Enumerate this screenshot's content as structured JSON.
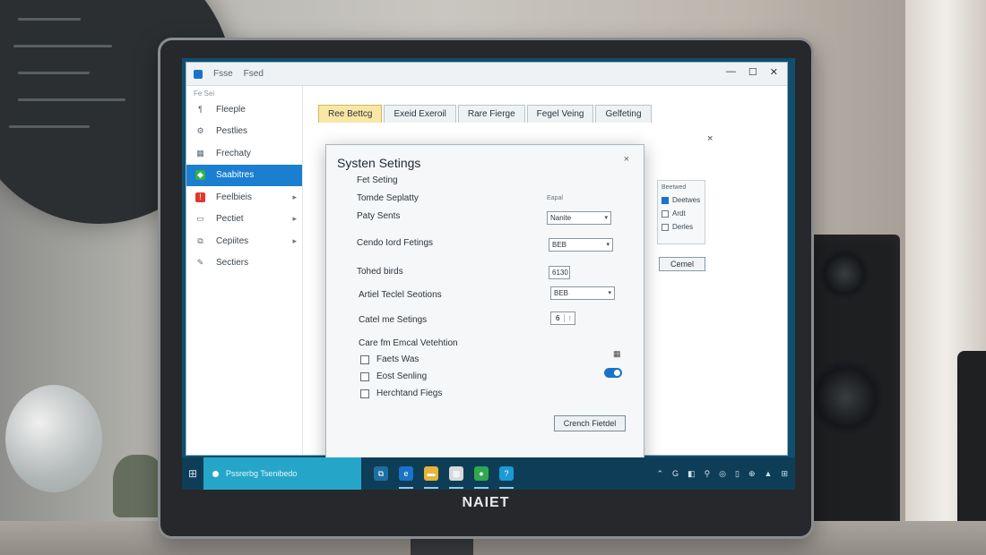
{
  "monitor": {
    "brand": "NAIET"
  },
  "app_window": {
    "titlebar": {
      "item1": "Fsse",
      "item2": "Fsed"
    },
    "controls": {
      "minimize": "—",
      "maximize": "☐",
      "close": "✕"
    }
  },
  "sidebar": {
    "header": "Fe Sei",
    "items": [
      {
        "label": "Fleeple",
        "icon": "user-icon",
        "glyph": "¶",
        "active": false,
        "chevron": false
      },
      {
        "label": "Pestlies",
        "icon": "gear-icon",
        "glyph": "⚙",
        "active": false,
        "chevron": false
      },
      {
        "label": "Frechaty",
        "icon": "calendar-icon",
        "glyph": "▦",
        "active": false,
        "chevron": false
      },
      {
        "label": "Saabitres",
        "icon": "shield-icon",
        "glyph": "◆",
        "active": true,
        "chevron": false
      },
      {
        "label": "Feelbieis",
        "icon": "alert-icon",
        "glyph": "!",
        "active": false,
        "chevron": true
      },
      {
        "label": "Pectiet",
        "icon": "document-icon",
        "glyph": "▭",
        "active": false,
        "chevron": true
      },
      {
        "label": "Cepiites",
        "icon": "copy-icon",
        "glyph": "⧉",
        "active": false,
        "chevron": true
      },
      {
        "label": "Sectiers",
        "icon": "wrench-icon",
        "glyph": "✎",
        "active": false,
        "chevron": false
      }
    ]
  },
  "tabs": [
    "Ree Bettcg",
    "Exeid Exeroil",
    "Rare Fierge",
    "Fegel Veing",
    "Gelfeting"
  ],
  "side_panel": {
    "title": "Beetwed",
    "options": [
      {
        "label": "Deetwes",
        "checked": true
      },
      {
        "label": "Ardt",
        "checked": false
      },
      {
        "label": "Derles",
        "checked": false
      }
    ],
    "cancel": "Cemel"
  },
  "dialog": {
    "title": "Systen Setings",
    "close": "×",
    "rows": {
      "fet_seting": "Fet Seting",
      "tomde": "Tomde Seplatty",
      "tomde_note": "Eapal",
      "patty": "Paty Sents",
      "patty_value": "Nanite",
      "cendo": "Cendo Iord Fetings",
      "cendo_value": "BEB",
      "tohed": "Tohed birds",
      "tohed_value": "6130",
      "artiel": "Artiel Teclel Seotions",
      "artiel_value": "BEB",
      "catel": "Catel me Setings",
      "catel_value": "6",
      "section": "Care fm Emcal Vetehtion"
    },
    "checkboxes": [
      {
        "label": "Faets Was",
        "checked": false
      },
      {
        "label": "Eost Senling",
        "checked": false
      },
      {
        "label": "Herchtand Fiegs",
        "checked": false
      }
    ],
    "toggle_on": true,
    "apply_button": "Crench Fietdel"
  },
  "taskbar": {
    "start": "⊞",
    "search_text": "Pssrerbg Tsenibedo",
    "apps": [
      {
        "icon": "task-view-icon",
        "glyph": "⧉",
        "color": "#1e6fa1",
        "running": false
      },
      {
        "icon": "browser-icon",
        "glyph": "e",
        "color": "#1a73c8",
        "running": true
      },
      {
        "icon": "folder-icon",
        "glyph": "▬",
        "color": "#e6b43a",
        "running": true
      },
      {
        "icon": "store-icon",
        "glyph": "▦",
        "color": "#d9d9d9",
        "running": true
      },
      {
        "icon": "chrome-icon",
        "glyph": "●",
        "color": "#2fa84f",
        "running": true
      },
      {
        "icon": "help-icon",
        "glyph": "?",
        "color": "#1a9ad6",
        "running": true
      }
    ],
    "tray": [
      "⌃",
      "G",
      "◧",
      "⚲",
      "◎",
      "▯",
      "⊕",
      "▲",
      "⊞"
    ]
  }
}
